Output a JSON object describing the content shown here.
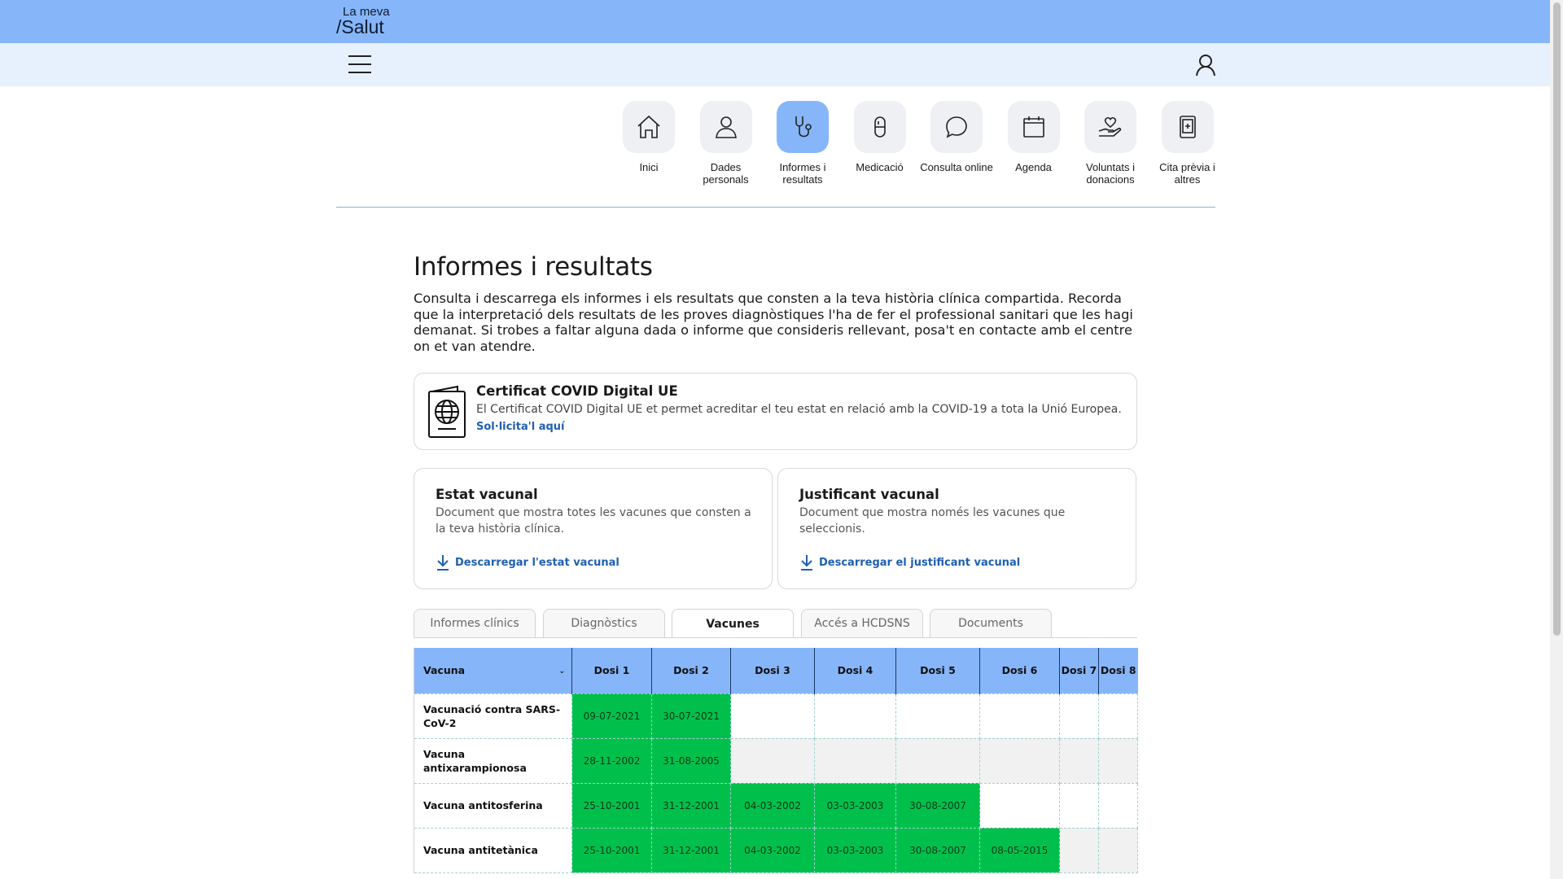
{
  "brand": {
    "line1": "La meva",
    "line2": "/Salut"
  },
  "menu": {
    "items": [
      {
        "label": "Inici",
        "icon": "home-icon"
      },
      {
        "label": "Dades personals",
        "icon": "person-icon"
      },
      {
        "label": "Informes i resultats",
        "icon": "stethoscope-icon",
        "active": true
      },
      {
        "label": "Medicació",
        "icon": "pill-icon"
      },
      {
        "label": "Consulta online",
        "icon": "chat-bubble-icon"
      },
      {
        "label": "Agenda",
        "icon": "calendar-icon"
      },
      {
        "label": "Voluntats i donacions",
        "icon": "heart-hand-icon"
      },
      {
        "label": "Cita prèvia i altres",
        "icon": "tablet-medical-icon"
      }
    ]
  },
  "page": {
    "title": "Informes i resultats",
    "intro": "Consulta i descarrega els informes i els resultats que consten a la teva història clínica compartida. Recorda que la interpretació dels resultats de les proves diagnòstiques l'ha de fer el professional sanitari que les hagi demanat. Si trobes a faltar alguna dada o informe que consideris rellevant, posa't en contacte amb el centre on et van atendre."
  },
  "covid": {
    "title": "Certificat COVID Digital UE",
    "description": "El Certificat COVID Digital UE et permet acreditar el teu estat en relació amb la COVID-19 a tota la Unió Europea.",
    "link": "Sol·licita'l aquí"
  },
  "estat": {
    "title": "Estat vacunal",
    "description": "Document que mostra totes les vacunes que consten a la teva història clínica.",
    "link": "Descarregar l'estat vacunal"
  },
  "justificant": {
    "title": "Justificant vacunal",
    "description": "Document que mostra només les vacunes que seleccionis.",
    "link": "Descarregar el justificant vacunal"
  },
  "tabs": [
    "Informes clínics",
    "Diagnòstics",
    "Vacunes",
    "Accés a HCDSNS",
    "Documents"
  ],
  "active_tab": "Vacunes",
  "table": {
    "headers": [
      "Vacuna",
      "Dosi 1",
      "Dosi 2",
      "Dosi 3",
      "Dosi 4",
      "Dosi 5",
      "Dosi 6",
      "Dosi 7",
      "Dosi 8"
    ],
    "rows": [
      {
        "vaccine": "Vacunació contra SARS-CoV-2",
        "doses": [
          "09-07-2021",
          "30-07-2021",
          "",
          "",
          "",
          "",
          "",
          ""
        ]
      },
      {
        "vaccine": "Vacuna antixarampionosa",
        "doses": [
          "28-11-2002",
          "31-08-2005",
          "",
          "",
          "",
          "",
          "",
          ""
        ]
      },
      {
        "vaccine": "Vacuna antitosferina",
        "doses": [
          "25-10-2001",
          "31-12-2001",
          "04-03-2002",
          "03-03-2003",
          "30-08-2007",
          "",
          "",
          ""
        ]
      },
      {
        "vaccine": "Vacuna antitetànica",
        "doses": [
          "25-10-2001",
          "31-12-2001",
          "04-03-2002",
          "03-03-2003",
          "30-08-2007",
          "08-05-2015",
          "",
          ""
        ]
      }
    ]
  },
  "colors": {
    "brand_blue": "#86b6f9",
    "nav_bg": "#e7f0fd",
    "filled_dose": "#00c04b",
    "link": "#1f5fb0"
  }
}
